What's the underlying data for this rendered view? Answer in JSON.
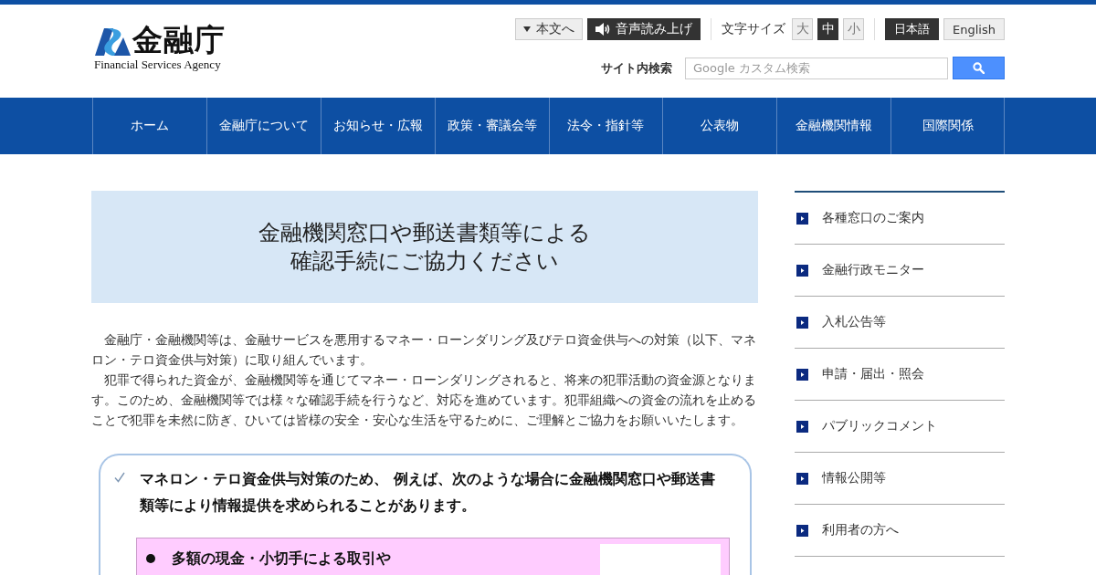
{
  "logo": {
    "name": "金融庁",
    "subtitle": "Financial Services Agency"
  },
  "utility": {
    "skip_link": "本文へ",
    "read_aloud": "音声読み上げ",
    "font_size_label": "文字サイズ",
    "font_sizes": [
      {
        "label": "大",
        "selected": false
      },
      {
        "label": "中",
        "selected": true
      },
      {
        "label": "小",
        "selected": false
      }
    ],
    "languages": [
      {
        "label": "日本語",
        "selected": true
      },
      {
        "label": "English",
        "selected": false
      }
    ]
  },
  "search": {
    "label": "サイト内検索",
    "placeholder": "Google カスタム検索"
  },
  "nav": {
    "items": [
      "ホーム",
      "金融庁について",
      "お知らせ・広報",
      "政策・審議会等",
      "法令・指針等",
      "公表物",
      "金融機関情報",
      "国際関係"
    ]
  },
  "hero": {
    "title_lines": [
      "金融機関窓口や郵送書類等による",
      "確認手続にご協力ください"
    ]
  },
  "intro_paragraphs": [
    "金融庁・金融機関等は、金融サービスを悪用するマネー・ローンダリング及びテロ資金供与への対策（以下、マネロン・テロ資金供与対策）に取り組んでいます。",
    "犯罪で得られた資金が、金融機関等を通じてマネー・ローンダリングされると、将来の犯罪活動の資金源となります。このため、金融機関等では様々な確認手続を行うなど、対応を進めています。犯罪組織への資金の流れを止めることで犯罪を未然に防ぎ、ひいては皆様の安全・安心な生活を守るために、ご理解とご協力をお願いいたします。"
  ],
  "notice": {
    "lead": "マネロン・テロ資金供与対策のため、 例えば、次のような場合に金融機関窓口や郵送書類等により情報提供を求められることがあります。",
    "examples": [
      "多額の現金・小切手による取引や"
    ]
  },
  "sidebar": {
    "items": [
      "各種窓口のご案内",
      "金融行政モニター",
      "入札公告等",
      "申請・届出・照会",
      "パブリックコメント",
      "情報公開等",
      "利用者の方へ"
    ]
  }
}
